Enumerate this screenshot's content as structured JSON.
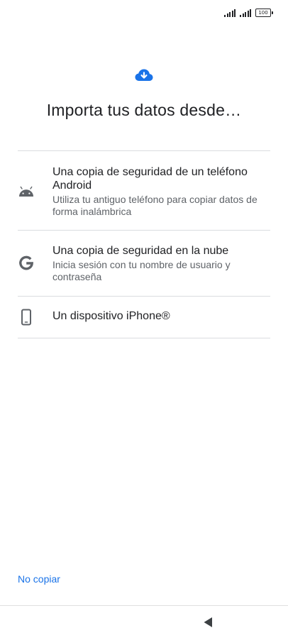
{
  "status_bar": {
    "battery_level": "100"
  },
  "header": {
    "icon": "cloud-download-icon",
    "title": "Importa tus datos desde…"
  },
  "options": [
    {
      "icon": "android-icon",
      "title": "Una copia de seguridad de un teléfono Android",
      "subtitle": "Utiliza tu antiguo teléfono para copiar datos de forma inalámbrica"
    },
    {
      "icon": "google-g-icon",
      "title": "Una copia de seguridad en la nube",
      "subtitle": "Inicia sesión con tu nombre de usuario y contraseña"
    },
    {
      "icon": "smartphone-icon",
      "title": "Un dispositivo iPhone®"
    }
  ],
  "footer": {
    "skip_label": "No copiar"
  },
  "navigation": {
    "back_icon": "back-triangle-icon"
  },
  "colors": {
    "accent": "#1a73e8",
    "primary_text": "#202124",
    "secondary_text": "#5f6368",
    "divider": "#dadce0"
  }
}
